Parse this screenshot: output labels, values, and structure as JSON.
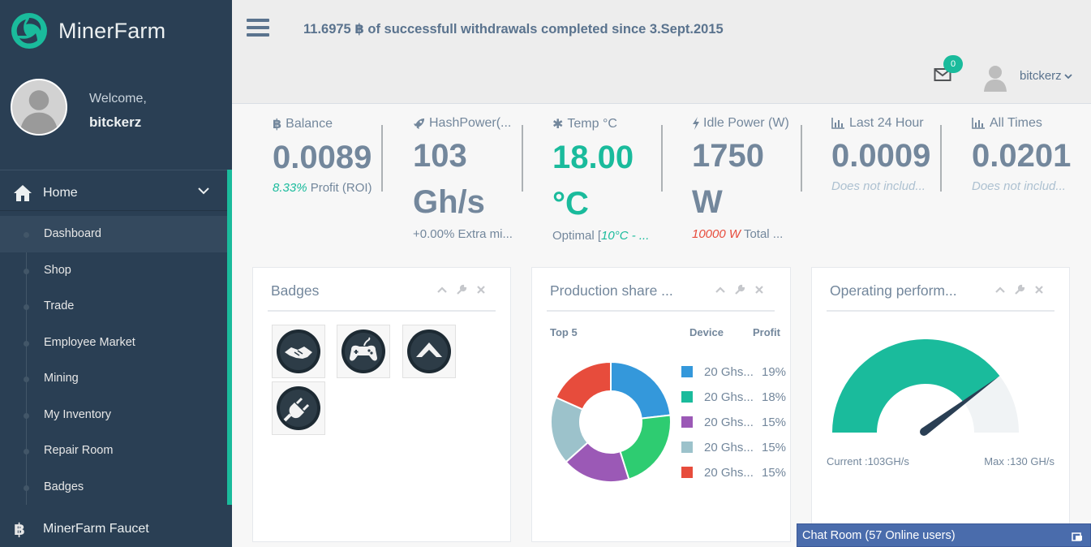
{
  "brand": {
    "name": "MinerFarm"
  },
  "profile": {
    "welcome_label": "Welcome,",
    "username": "bitckerz"
  },
  "sidebar": {
    "home_label": "Home",
    "items": [
      {
        "label": "Dashboard"
      },
      {
        "label": "Shop"
      },
      {
        "label": "Trade"
      },
      {
        "label": "Employee Market"
      },
      {
        "label": "Mining"
      },
      {
        "label": "My Inventory"
      },
      {
        "label": "Repair Room"
      },
      {
        "label": "Badges"
      }
    ],
    "faucet_label": "MinerFarm Faucet",
    "faucet_icon": "฿"
  },
  "topnav": {
    "announcement": "11.6975 ฿ of successfull withdrawals completed since 3.Sept.2015",
    "mail_count": "0",
    "username": "bitckerz"
  },
  "tiles": {
    "balance": {
      "icon": "฿",
      "label": "Balance",
      "value": "0.0089",
      "sub_highlight": "8.33%",
      "sub_text": " Profit (ROI)"
    },
    "hashpower": {
      "label": "HashPower(...",
      "value_line1": "103",
      "value_line2": "Gh/s",
      "sub_text": "+0.00% Extra mi..."
    },
    "temp": {
      "label": "Temp °C",
      "value_line1": "18.00",
      "value_line2": "°C",
      "sub_text": "Optimal [",
      "sub_highlight": "10°C - ..."
    },
    "idle": {
      "label": "Idle Power (W)",
      "value_line1": "1750",
      "value_line2": "W",
      "sub_highlight": "10000 W",
      "sub_text": " Total ..."
    },
    "last24": {
      "label": "Last 24 Hour",
      "value": "0.0009",
      "sub_text": "Does not includ..."
    },
    "alltimes": {
      "label": "All Times",
      "value": "0.0201",
      "sub_text": "Does not includ..."
    }
  },
  "panels": {
    "badges": {
      "title": "Badges",
      "icons": [
        "handshake-icon",
        "gamepad-icon",
        "chevron-up-icon",
        "plug-icon"
      ]
    },
    "production": {
      "title": "Production share ...",
      "col_top": "Top 5",
      "col_device": "Device",
      "col_profit": "Profit",
      "legend": [
        {
          "device": "20 Ghs...",
          "pct": "19%",
          "color": "#3498db"
        },
        {
          "device": "20 Ghs...",
          "pct": "18%",
          "color": "#1abb9c"
        },
        {
          "device": "20 Ghs...",
          "pct": "15%",
          "color": "#9b59b6"
        },
        {
          "device": "20 Ghs...",
          "pct": "15%",
          "color": "#9cc2cb"
        },
        {
          "device": "20 Ghs...",
          "pct": "15%",
          "color": "#e74c3c"
        }
      ]
    },
    "operating": {
      "title": "Operating perform...",
      "current_label": "Current :103GH/s",
      "max_label": "Max :130 GH/s"
    }
  },
  "chart_data": {
    "type": "pie",
    "title": "Production share ...",
    "categories": [
      "20 Ghs...",
      "20 Ghs...",
      "20 Ghs...",
      "20 Ghs...",
      "20 Ghs..."
    ],
    "values": [
      19,
      18,
      15,
      15,
      15
    ],
    "colors": [
      "#3498db",
      "#2ecc71",
      "#9b59b6",
      "#9cc2cb",
      "#e74c3c"
    ],
    "donut": true
  },
  "gauge": {
    "value": 103,
    "max": 130,
    "color": "#1abb9c",
    "track_color": "#f0f3f5"
  },
  "chat": {
    "label": "Chat Room (57 Online users)"
  },
  "colors": {
    "sidebar": "#2a3f54",
    "accent": "#1abb9c",
    "text": "#73879c",
    "danger": "#e74c3c"
  }
}
